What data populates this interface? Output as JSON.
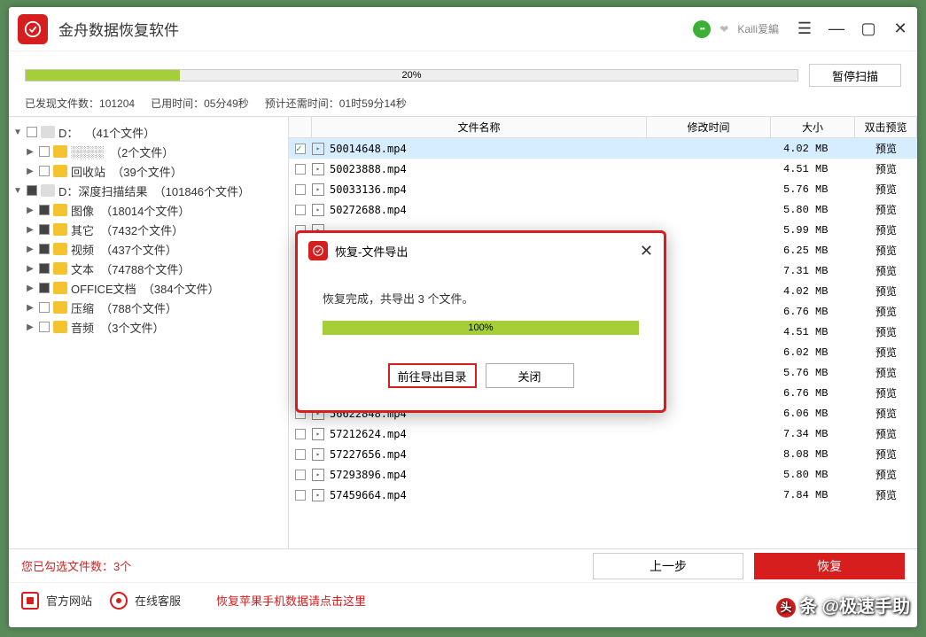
{
  "app": {
    "title": "金舟数据恢复软件"
  },
  "user": {
    "name": "Kaili爱編"
  },
  "progress": {
    "main_percent_label": "20%",
    "main_percent": 20,
    "pause_label": "暂停扫描",
    "found_label": "已发现文件数：",
    "found_value": "101204",
    "elapsed_label": "已用时间：",
    "elapsed_value": "05分49秒",
    "remain_label": "预计还需时间：",
    "remain_value": "01时59分14秒"
  },
  "tree": [
    {
      "arrow": "open",
      "indent": 0,
      "chk": "empty",
      "icon": "disk",
      "label": "D：",
      "count": "（41个文件）"
    },
    {
      "arrow": "closed",
      "indent": 1,
      "chk": "empty",
      "icon": "folder",
      "label": "░░░░",
      "count": "（2个文件）"
    },
    {
      "arrow": "closed",
      "indent": 1,
      "chk": "empty",
      "icon": "folder",
      "label": "回收站",
      "count": "（39个文件）"
    },
    {
      "arrow": "open",
      "indent": 0,
      "chk": "filled",
      "icon": "disk",
      "label": "D：深度扫描结果",
      "count": "（101846个文件）"
    },
    {
      "arrow": "closed",
      "indent": 1,
      "chk": "filled",
      "icon": "folder",
      "label": "图像",
      "count": "（18014个文件）"
    },
    {
      "arrow": "closed",
      "indent": 1,
      "chk": "filled",
      "icon": "folder",
      "label": "其它",
      "count": "（7432个文件）"
    },
    {
      "arrow": "closed",
      "indent": 1,
      "chk": "filled",
      "icon": "folder",
      "label": "视频",
      "count": "（437个文件）"
    },
    {
      "arrow": "closed",
      "indent": 1,
      "chk": "filled",
      "icon": "folder",
      "label": "文本",
      "count": "（74788个文件）"
    },
    {
      "arrow": "closed",
      "indent": 1,
      "chk": "filled",
      "icon": "folder",
      "label": "OFFICE文档",
      "count": "（384个文件）"
    },
    {
      "arrow": "closed",
      "indent": 1,
      "chk": "empty",
      "icon": "folder",
      "label": "压缩",
      "count": "（788个文件）"
    },
    {
      "arrow": "closed",
      "indent": 1,
      "chk": "empty",
      "icon": "folder",
      "label": "音频",
      "count": "（3个文件）"
    }
  ],
  "headers": {
    "name": "文件名称",
    "date": "修改时间",
    "size": "大小",
    "preview": "双击预览"
  },
  "files": [
    {
      "name": "50014648.mp4",
      "size": "4.02 MB",
      "preview": "预览",
      "selected": true,
      "checked": true
    },
    {
      "name": "50023888.mp4",
      "size": "4.51 MB",
      "preview": "预览"
    },
    {
      "name": "50033136.mp4",
      "size": "5.76 MB",
      "preview": "预览"
    },
    {
      "name": "50272688.mp4",
      "size": "5.80 MB",
      "preview": "预览"
    },
    {
      "name": "",
      "size": "5.99 MB",
      "preview": "预览"
    },
    {
      "name": "",
      "size": "6.25 MB",
      "preview": "预览"
    },
    {
      "name": "",
      "size": "7.31 MB",
      "preview": "预览"
    },
    {
      "name": "",
      "size": "4.02 MB",
      "preview": "预览"
    },
    {
      "name": "",
      "size": "6.76 MB",
      "preview": "预览"
    },
    {
      "name": "",
      "size": "4.51 MB",
      "preview": "预览"
    },
    {
      "name": "",
      "size": "6.02 MB",
      "preview": "预览"
    },
    {
      "name": "",
      "size": "5.76 MB",
      "preview": "预览"
    },
    {
      "name": "",
      "size": "6.76 MB",
      "preview": "预览"
    },
    {
      "name": "56622848.mp4",
      "size": "6.06 MB",
      "preview": "预览"
    },
    {
      "name": "57212624.mp4",
      "size": "7.34 MB",
      "preview": "预览"
    },
    {
      "name": "57227656.mp4",
      "size": "8.08 MB",
      "preview": "预览"
    },
    {
      "name": "57293896.mp4",
      "size": "5.80 MB",
      "preview": "预览"
    },
    {
      "name": "57459664.mp4",
      "size": "7.84 MB",
      "preview": "预览"
    }
  ],
  "modal": {
    "title": "恢复-文件导出",
    "message": "恢复完成，共导出 3 个文件。",
    "percent_label": "100%",
    "goto_btn": "前往导出目录",
    "close_btn": "关闭"
  },
  "bottom": {
    "selected_label": "您已勾选文件数：",
    "selected_count": "3个",
    "prev_btn": "上一步",
    "recover_btn": "恢复"
  },
  "footer": {
    "official": "官方网站",
    "support": "在线客服",
    "promo": "恢复苹果手机数据请点击这里"
  },
  "watermark": "头条 @极速手助"
}
